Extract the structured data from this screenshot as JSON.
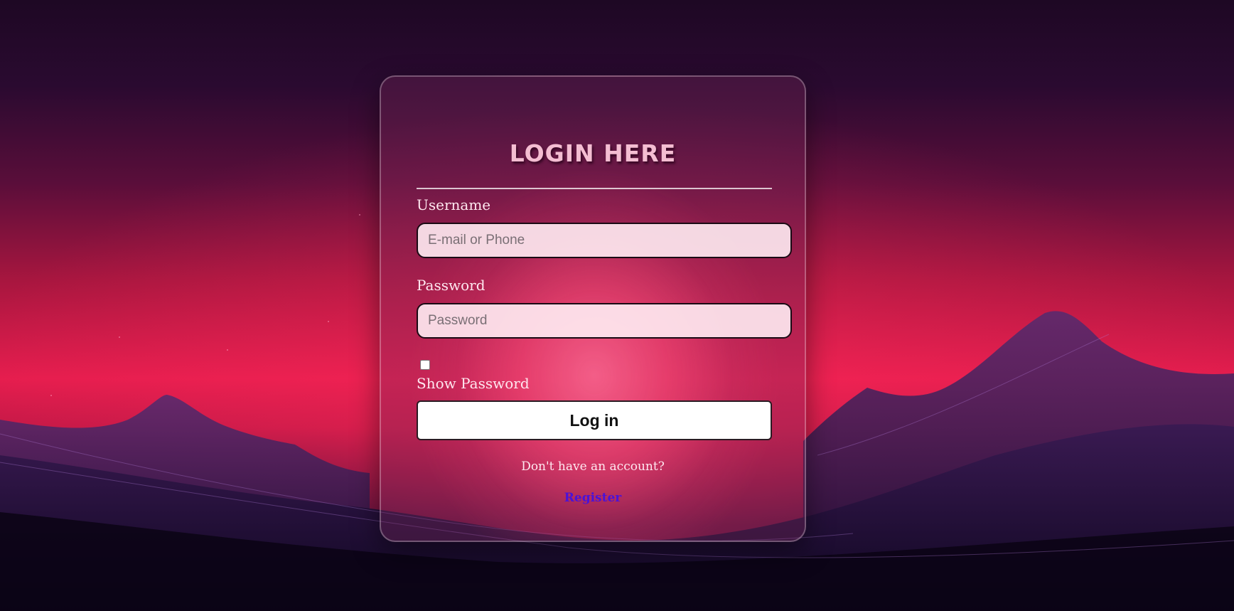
{
  "login": {
    "title": "LOGIN HERE",
    "username_label": "Username",
    "username_placeholder": "E-mail or Phone",
    "password_label": "Password",
    "password_placeholder": "Password",
    "show_password_label": "Show Password",
    "login_button": "Log in",
    "no_account_text": "Don't have an account?",
    "register_link": "Register"
  },
  "colors": {
    "title": "#f4bdd2",
    "register_link": "#4a12d8",
    "button_bg": "#ffffff",
    "accent_pink": "#e51d4e"
  }
}
